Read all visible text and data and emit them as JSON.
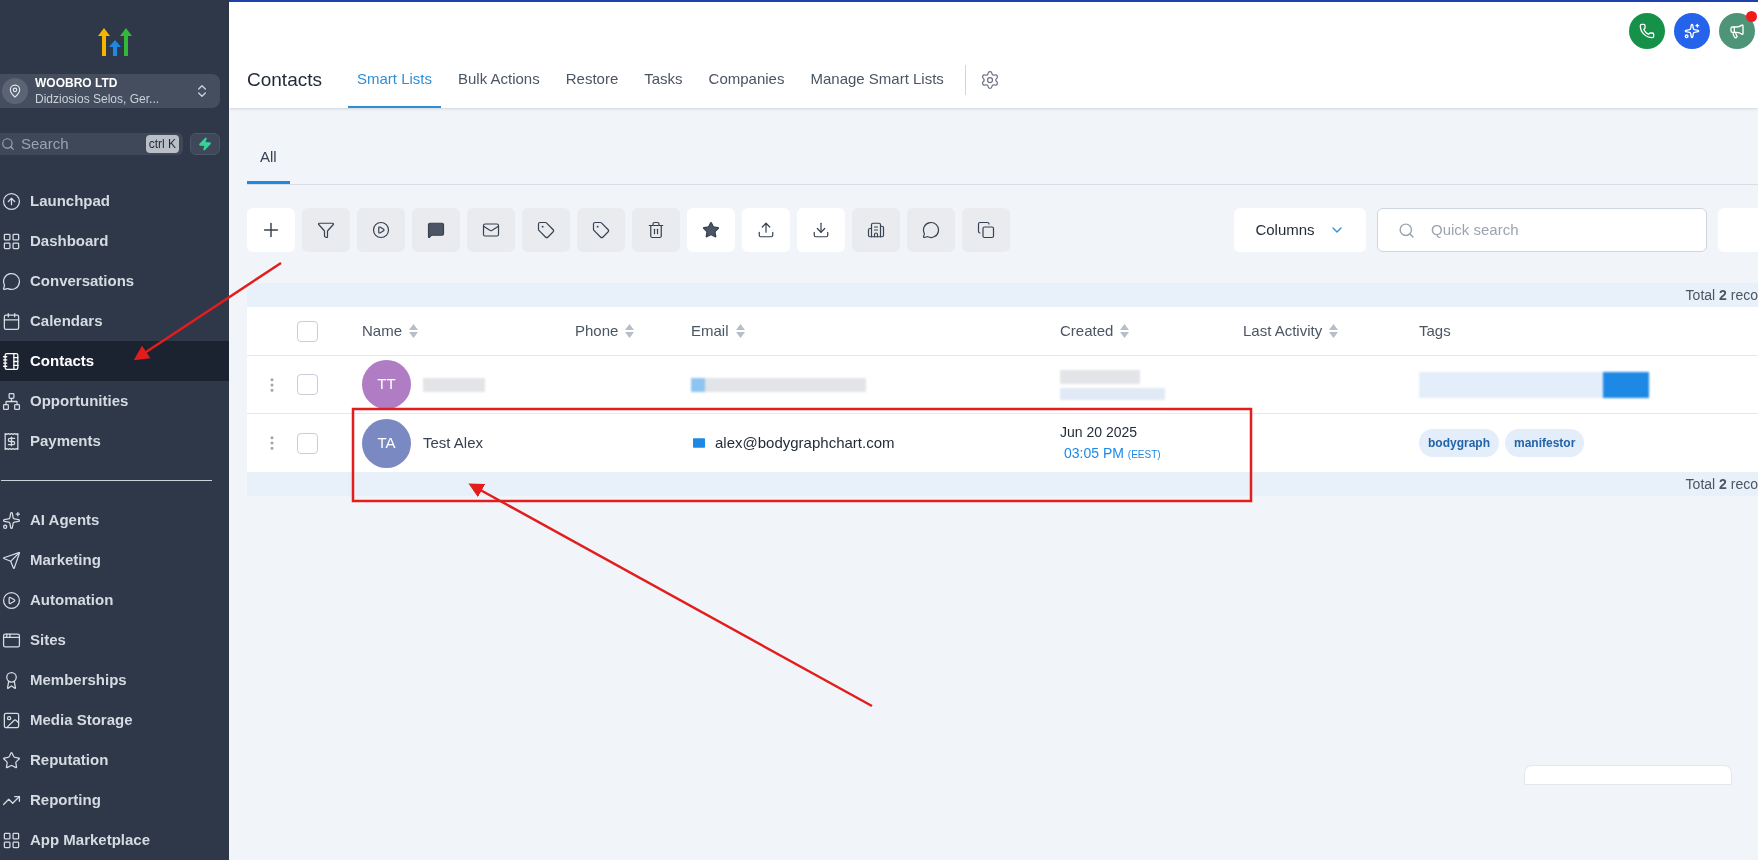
{
  "sidebar": {
    "account": {
      "name": "WOOBRO LTD",
      "address": "Didziosios Selos, Ger..."
    },
    "search": {
      "placeholder": "Search",
      "shortcut": "ctrl K"
    },
    "nav_groups": [
      [
        {
          "label": "Launchpad",
          "selected": false
        },
        {
          "label": "Dashboard",
          "selected": false
        },
        {
          "label": "Conversations",
          "selected": false
        },
        {
          "label": "Calendars",
          "selected": false
        },
        {
          "label": "Contacts",
          "selected": true
        },
        {
          "label": "Opportunities",
          "selected": false
        },
        {
          "label": "Payments",
          "selected": false
        }
      ],
      [
        {
          "label": "AI Agents",
          "selected": false
        },
        {
          "label": "Marketing",
          "selected": false
        },
        {
          "label": "Automation",
          "selected": false
        },
        {
          "label": "Sites",
          "selected": false
        },
        {
          "label": "Memberships",
          "selected": false
        },
        {
          "label": "Media Storage",
          "selected": false
        },
        {
          "label": "Reputation",
          "selected": false
        },
        {
          "label": "Reporting",
          "selected": false
        },
        {
          "label": "App Marketplace",
          "selected": false
        }
      ]
    ]
  },
  "header": {
    "title": "Contacts",
    "notification_badge": true,
    "tabs": [
      {
        "label": "Smart Lists",
        "selected": true
      },
      {
        "label": "Bulk Actions",
        "selected": false
      },
      {
        "label": "Restore",
        "selected": false
      },
      {
        "label": "Tasks",
        "selected": false
      },
      {
        "label": "Companies",
        "selected": false
      },
      {
        "label": "Manage Smart Lists",
        "selected": false
      }
    ]
  },
  "list_tabs": [
    {
      "label": "All",
      "selected": true
    }
  ],
  "toolbar": {
    "buttons": [
      {
        "disabled": false
      },
      {
        "disabled": true
      },
      {
        "disabled": true
      },
      {
        "disabled": true
      },
      {
        "disabled": true
      },
      {
        "disabled": true
      },
      {
        "disabled": true
      },
      {
        "disabled": true
      },
      {
        "disabled": false
      },
      {
        "disabled": false
      },
      {
        "disabled": false
      },
      {
        "disabled": true
      },
      {
        "disabled": true
      },
      {
        "disabled": true
      }
    ],
    "columns_button": "Columns",
    "quick_search": {
      "placeholder": "Quick search"
    }
  },
  "table": {
    "total_top": "Total **2** reco",
    "select_all_checked": false,
    "columns": [
      {
        "label": "Name",
        "sortable": true
      },
      {
        "label": "Phone",
        "sortable": true
      },
      {
        "label": "Email",
        "sortable": true
      },
      {
        "label": "Created",
        "sortable": true
      },
      {
        "label": "Last Activity",
        "sortable": true
      },
      {
        "label": "Tags",
        "sortable": false
      }
    ],
    "rows": [
      {
        "kind": "redacted",
        "checked": false,
        "initials": "TT",
        "color": "#b07cc4"
      },
      {
        "kind": "contact",
        "checked": false,
        "initials": "TA",
        "color": "#7a89c2",
        "name": "Test Alex",
        "email": "alex@bodygraphchart.com",
        "created_date": "Jun 20 2025",
        "created_time": "03:05 PM",
        "timezone": "(EEST)",
        "tags": [
          "bodygraph",
          "manifestor"
        ]
      }
    ],
    "total_bottom": "Total **2** reco"
  }
}
